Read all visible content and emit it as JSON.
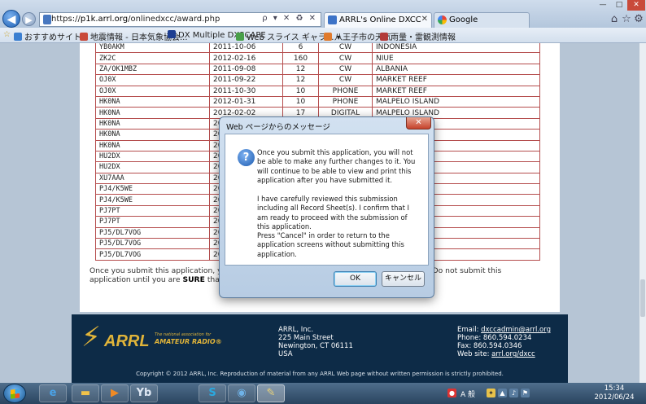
{
  "browser": {
    "url_prefix": "https://",
    "url_domain": "p1k.arrl.org",
    "url_path": "/onlinedxcc/award.php",
    "address_tools": "ρ ▾ ✕ ♻ ✕",
    "tabs": [
      {
        "title": "ARRL's Online DXCC",
        "close": "✕"
      },
      {
        "title": "Google"
      }
    ],
    "window_controls": {
      "minimize": "—",
      "maximize": "□",
      "close": "✕"
    },
    "toolbar_icons": {
      "home": "⌂",
      "favorites": "☆",
      "tools": "⚙"
    }
  },
  "favorites_bar": {
    "favorites_icon": "☆",
    "items": [
      {
        "label": "おすすめサイト ▾",
        "color": "#3b7fd1"
      },
      {
        "label": "地震情報 - 日本気象協会...",
        "color": "#c94a3a"
      },
      {
        "label": "DX Multiple DXSCAPE",
        "color": "#1c3d91"
      },
      {
        "label": "Web スライス ギャラ...  ▾",
        "color": "#49a04a"
      },
      {
        "label": "八王子市の天気",
        "color": "#e07a2c"
      },
      {
        "label": "雨量・雷観測情報",
        "color": "#b23a3a"
      }
    ]
  },
  "records": [
    {
      "call": "YB0AKM",
      "date": "2011-10-06",
      "qsl": "6",
      "mode": "CW",
      "entity": "INDONESIA"
    },
    {
      "call": "ZK2C",
      "date": "2012-02-16",
      "qsl": "160",
      "mode": "CW",
      "entity": "NIUE"
    },
    {
      "call": "ZA/OK1MBZ",
      "date": "2011-09-08",
      "qsl": "12",
      "mode": "CW",
      "entity": "ALBANIA"
    },
    {
      "call": "OJ0X",
      "date": "2011-09-22",
      "qsl": "12",
      "mode": "CW",
      "entity": "MARKET REEF"
    },
    {
      "call": "OJ0X",
      "date": "2011-10-30",
      "qsl": "10",
      "mode": "PHONE",
      "entity": "MARKET REEF"
    },
    {
      "call": "HK0NA",
      "date": "2012-01-31",
      "qsl": "10",
      "mode": "PHONE",
      "entity": "MALPELO ISLAND"
    },
    {
      "call": "HK0NA",
      "date": "2012-02-02",
      "qsl": "17",
      "mode": "DIGITAL",
      "entity": "MALPELO ISLAND"
    },
    {
      "call": "HK0NA",
      "date": "20",
      "qsl": "",
      "mode": "",
      "entity": ""
    },
    {
      "call": "HK0NA",
      "date": "20",
      "qsl": "",
      "mode": "",
      "entity": ""
    },
    {
      "call": "HK0NA",
      "date": "20",
      "qsl": "",
      "mode": "",
      "entity": ""
    },
    {
      "call": "HU2DX",
      "date": "20",
      "qsl": "",
      "mode": "",
      "entity": ""
    },
    {
      "call": "HU2DX",
      "date": "20",
      "qsl": "",
      "mode": "",
      "entity": ""
    },
    {
      "call": "XU7AAA",
      "date": "20",
      "qsl": "",
      "mode": "",
      "entity": ""
    },
    {
      "call": "PJ4/K5WE",
      "date": "20",
      "qsl": "",
      "mode": "",
      "entity": ""
    },
    {
      "call": "PJ4/K5WE",
      "date": "20",
      "qsl": "",
      "mode": "",
      "entity": ""
    },
    {
      "call": "PJ7PT",
      "date": "20",
      "qsl": "",
      "mode": "",
      "entity": ""
    },
    {
      "call": "PJ7PT",
      "date": "20",
      "qsl": "",
      "mode": "",
      "entity": ""
    },
    {
      "call": "PJ5/DL7VOG",
      "date": "20",
      "qsl": "",
      "mode": "",
      "entity": "US"
    },
    {
      "call": "PJ5/DL7VOG",
      "date": "20",
      "qsl": "",
      "mode": "",
      "entity": "US"
    },
    {
      "call": "PJ5/DL7VOG",
      "date": "20",
      "qsl": "",
      "mode": "",
      "entity": "US"
    }
  ],
  "warning": {
    "line1_a": "Once you submit this application, you w",
    "line1_b": "this submission. Do not submit this",
    "line2_a": "application until you are ",
    "line2_strong": "SURE",
    "line2_b": " that eve"
  },
  "footer": {
    "logo_mark": "⚡",
    "logo_text": "ARRL",
    "logo_tagline1": "The national association for",
    "logo_tagline2": "AMATEUR RADIO®",
    "address": [
      "ARRL, Inc.",
      "225 Main Street",
      "Newington, CT 06111",
      "USA"
    ],
    "email_label": "Email: ",
    "email": "dxccadmin@arrl.org",
    "phone": "Phone: 860.594.0234",
    "fax": "Fax: 860.594.0346",
    "website_label": "Web site: ",
    "website": "arrl.org/dxcc",
    "copyright": "Copyright © 2012 ARRL, Inc. Reproduction of material from any ARRL Web page without written permission is strictly prohibited."
  },
  "dialog": {
    "title": "Web ページからのメッセージ",
    "close": "✕",
    "icon": "?",
    "paragraph1": "Once you submit this application, you will not be able to make any further changes to it. You will continue to be able to view and print this application after you have submitted it.",
    "paragraph2": "I have carefully reviewed this submission including all Record Sheet(s). I confirm that I am ready to proceed with the submission of this application.",
    "paragraph3": "Press \"Cancel\" in order to return to the application screens without submitting this application.",
    "ok_label": "OK",
    "cancel_label": "キャンセル"
  },
  "taskbar": {
    "apps": [
      {
        "name": "ie",
        "glyph": "e",
        "color": "#4aa3e8"
      },
      {
        "name": "explorer",
        "glyph": "▬",
        "color": "#f0c24a"
      },
      {
        "name": "media-player",
        "glyph": "▶",
        "color": "#f08a24"
      },
      {
        "name": "yb-app",
        "glyph": "Yb",
        "color": "#dfe8f4"
      },
      {
        "name": "skype",
        "glyph": "S",
        "color": "#2aa9e0"
      },
      {
        "name": "globe",
        "glyph": "◉",
        "color": "#6fb3e8"
      },
      {
        "name": "paint",
        "glyph": "✎",
        "color": "#e8d27a"
      }
    ],
    "tray": {
      "ime": "A 般",
      "icons": [
        "●",
        "✦",
        "▲",
        "♪",
        "⚑"
      ]
    },
    "time": "15:34",
    "date": "2012/06/24"
  }
}
